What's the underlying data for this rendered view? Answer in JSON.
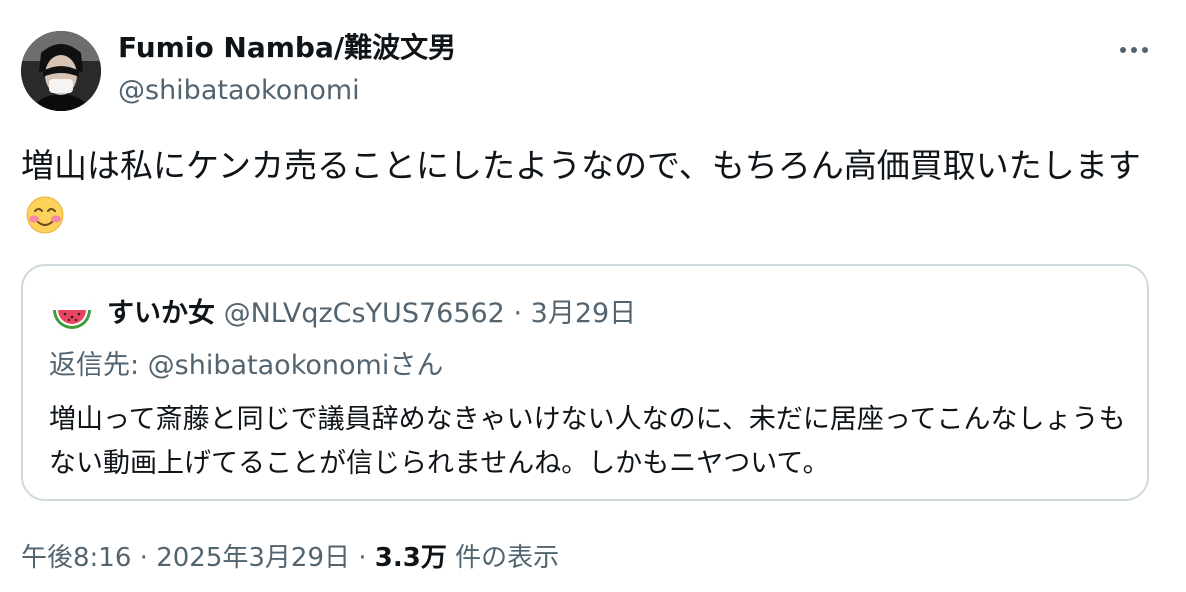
{
  "author": {
    "name": "Fumio Namba/難波文男",
    "handle": "@shibataokonomi",
    "avatar": "avatar-photo"
  },
  "actions": {
    "more_icon": "more-horizontal-icon"
  },
  "tweet": {
    "text": "増山は私にケンカ売ることにしたようなので、もちろん高価買取いたします",
    "emoji": "smiling-face-blushing-emoji"
  },
  "quote": {
    "name": "すいか女",
    "handle": "@NLVqzCsYUS76562",
    "separator": "·",
    "date": "3月29日",
    "reply_to": "返信先: @shibataokonomiさん",
    "text": "増山って斎藤と同じで議員辞めなきゃいけない人なのに、未だに居座ってこんなしょうもない動画上げてることが信じられませんね。しかもニヤついて。",
    "avatar": "watermelon-icon"
  },
  "meta": {
    "time": "午後8:16",
    "separator1": "·",
    "date": "2025年3月29日",
    "separator2": "·",
    "views": "3.3万",
    "views_label": "件の表示"
  },
  "colors": {
    "text_primary": "#0f1419",
    "text_secondary": "#536471",
    "border": "#cfd9de"
  }
}
